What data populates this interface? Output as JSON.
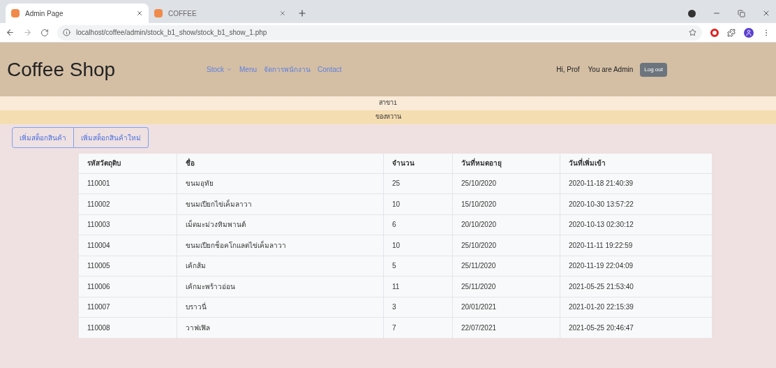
{
  "browser": {
    "tabs": [
      {
        "title": "Admin Page",
        "selected": true
      },
      {
        "title": "COFFEE",
        "selected": false
      }
    ],
    "url": "localhost/coffee/admin/stock_b1_show/stock_b1_show_1.php"
  },
  "header": {
    "brand": "Coffee Shop",
    "nav": [
      {
        "label": "Stock",
        "dropdown": true
      },
      {
        "label": "Menu",
        "dropdown": false
      },
      {
        "label": "จัดการพนักงาน",
        "dropdown": false
      },
      {
        "label": "Contact",
        "dropdown": false
      }
    ],
    "greeting": "Hi, Prof",
    "role": "You are Admin",
    "logout": "Log out"
  },
  "branch": "สาขา1",
  "category": "ของหวาน",
  "actions": [
    "เพิ่มสต็อกสินค้า",
    "เพิ่มสต็อกสินค้าใหม่"
  ],
  "table": {
    "columns": [
      "รหัสวัตถุดิบ",
      "ชื่อ",
      "จำนวน",
      "วันที่หมดอายุ",
      "วันที่เพิ่มเข้า"
    ],
    "rows": [
      [
        "110001",
        "ขนมอุทัย",
        "25",
        "25/10/2020",
        "2020-11-18 21:40:39"
      ],
      [
        "110002",
        "ขนมเปียกไข่เค็มลาวา",
        "10",
        "15/10/2020",
        "2020-10-30 13:57:22"
      ],
      [
        "110003",
        "เม็ดมะม่วงหิมพานต์",
        "6",
        "20/10/2020",
        "2020-10-13 02:30:12"
      ],
      [
        "110004",
        "ขนมเปียกช็อคโกแลตไข่เค็มลาวา",
        "10",
        "25/10/2020",
        "2020-11-11 19:22:59"
      ],
      [
        "110005",
        "เค้กส้ม",
        "5",
        "25/11/2020",
        "2020-11-19 22:04:09"
      ],
      [
        "110006",
        "เค้กมะพร้าวอ่อน",
        "11",
        "25/11/2020",
        "2021-05-25 21:53:40"
      ],
      [
        "110007",
        "บราวนี่",
        "3",
        "20/01/2021",
        "2021-01-20 22:15:39"
      ],
      [
        "110008",
        "วาฟเฟิล",
        "7",
        "22/07/2021",
        "2021-05-25 20:46:47"
      ]
    ]
  }
}
